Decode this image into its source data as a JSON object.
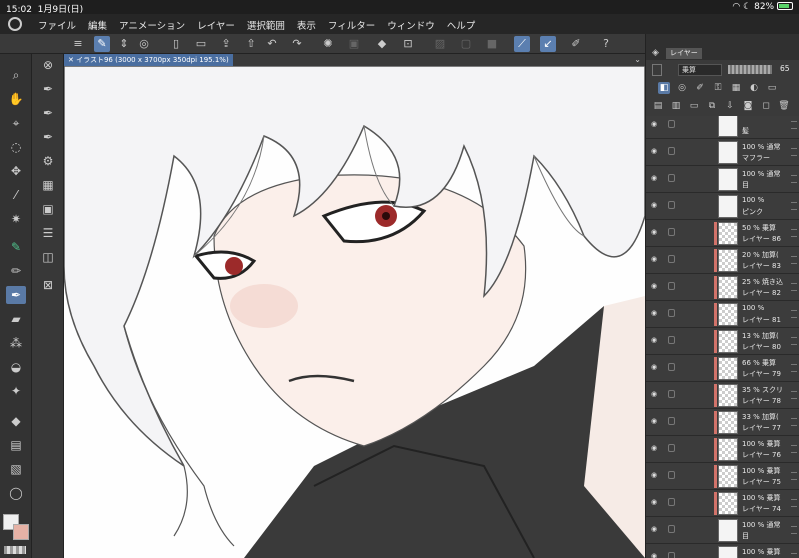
{
  "status": {
    "time": "15:02",
    "date": "1月9日(日)",
    "battery": "82%"
  },
  "menu": [
    "ファイル",
    "編集",
    "アニメーション",
    "レイヤー",
    "選択範囲",
    "表示",
    "フィルター",
    "ウィンドウ",
    "ヘルプ"
  ],
  "canvas_tab": "イラスト96 (3000 x 3700px 350dpi 195.1%)",
  "panel": {
    "tab": "レイヤー",
    "blend_mode": "乗算",
    "opacity": "65"
  },
  "layers": [
    {
      "opacity": "",
      "mode": "",
      "name": "髪",
      "clip": false,
      "solid": true
    },
    {
      "opacity": "100 %",
      "mode": "通常",
      "name": "マフラー",
      "clip": false,
      "solid": true
    },
    {
      "opacity": "100 %",
      "mode": "通常",
      "name": "目",
      "clip": false,
      "solid": true
    },
    {
      "opacity": "100 %",
      "mode": "",
      "name": "ピンク",
      "clip": false,
      "solid": true
    },
    {
      "opacity": "50 %",
      "mode": "乗算",
      "name": "レイヤー 86",
      "clip": true,
      "solid": false
    },
    {
      "opacity": "20 %",
      "mode": "加算(",
      "name": "レイヤー 83",
      "clip": true,
      "solid": false
    },
    {
      "opacity": "25 %",
      "mode": "焼き込",
      "name": "レイヤー 82",
      "clip": true,
      "solid": false
    },
    {
      "opacity": "100 %",
      "mode": "",
      "name": "レイヤー 81",
      "clip": true,
      "solid": false
    },
    {
      "opacity": "13 %",
      "mode": "加算(",
      "name": "レイヤー 80",
      "clip": true,
      "solid": false
    },
    {
      "opacity": "66 %",
      "mode": "乗算",
      "name": "レイヤー 79",
      "clip": true,
      "solid": false
    },
    {
      "opacity": "35 %",
      "mode": "スクリ",
      "name": "レイヤー 78",
      "clip": true,
      "solid": false
    },
    {
      "opacity": "33 %",
      "mode": "加算(",
      "name": "レイヤー 77",
      "clip": true,
      "solid": false
    },
    {
      "opacity": "100 %",
      "mode": "乗算",
      "name": "レイヤー 76",
      "clip": true,
      "solid": false
    },
    {
      "opacity": "100 %",
      "mode": "乗算",
      "name": "レイヤー 75",
      "clip": true,
      "solid": false
    },
    {
      "opacity": "100 %",
      "mode": "乗算",
      "name": "レイヤー 74",
      "clip": true,
      "solid": false
    },
    {
      "opacity": "100 %",
      "mode": "通常",
      "name": "目",
      "clip": false,
      "solid": true
    },
    {
      "opacity": "100 %",
      "mode": "乗算",
      "name": "",
      "clip": false,
      "solid": true
    }
  ],
  "colors": {
    "accent": "#5a7aa6",
    "clip_bar": "#d2736a",
    "main_color": "#f0f0f0",
    "sub_color": "#e6b2a6"
  }
}
